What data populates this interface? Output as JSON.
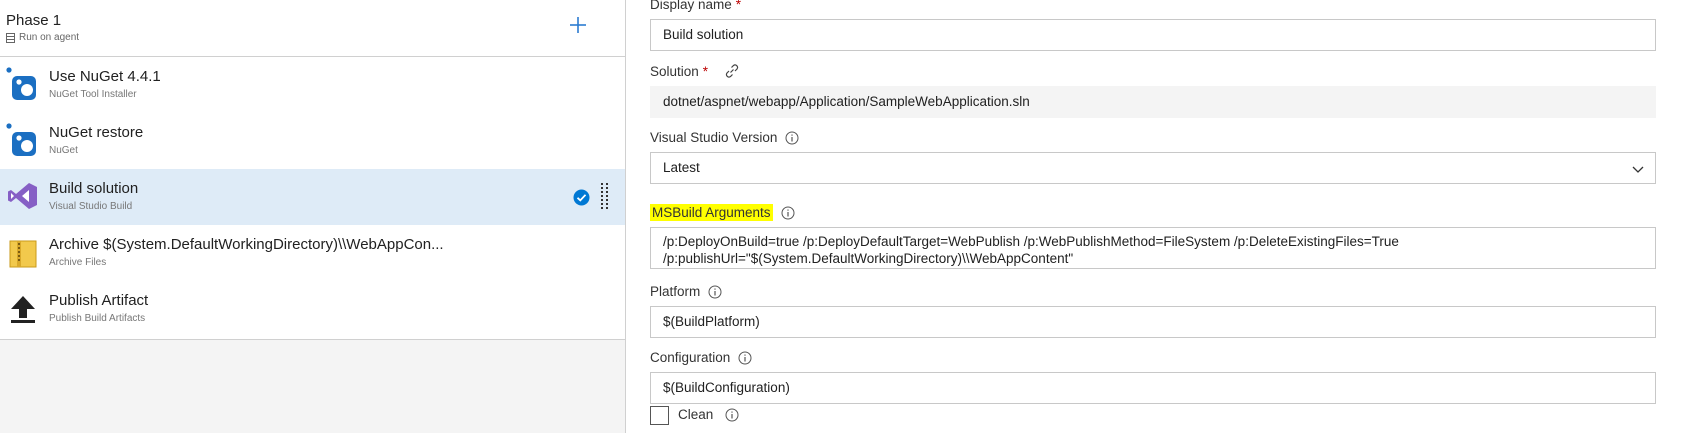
{
  "phase": {
    "title": "Phase 1",
    "subtitle": "Run on agent",
    "icons": {
      "agent": "server-icon",
      "add": "plus-icon"
    }
  },
  "tasks": [
    {
      "title": "Use NuGet 4.4.1",
      "subtitle": "NuGet Tool Installer",
      "icon": "nuget-icon",
      "selected": false
    },
    {
      "title": "NuGet restore",
      "subtitle": "NuGet",
      "icon": "nuget-icon",
      "selected": false
    },
    {
      "title": "Build solution",
      "subtitle": "Visual Studio Build",
      "icon": "visual-studio-icon",
      "selected": true
    },
    {
      "title": "Archive $(System.DefaultWorkingDirectory)\\\\WebAppCon...",
      "subtitle": "Archive Files",
      "icon": "archive-icon",
      "selected": false
    },
    {
      "title": "Publish Artifact",
      "subtitle": "Publish Build Artifacts",
      "icon": "upload-arrow-icon",
      "selected": false
    }
  ],
  "form": {
    "display_name": {
      "label": "Display name",
      "required": "*",
      "value": "Build solution"
    },
    "solution": {
      "label": "Solution",
      "required": "*",
      "value": "dotnet/aspnet/webapp/Application/SampleWebApplication.sln"
    },
    "vs_version": {
      "label": "Visual Studio Version",
      "value": "Latest"
    },
    "msbuild_args": {
      "label": "MSBuild Arguments",
      "line1": "/p:DeployOnBuild=true /p:DeployDefaultTarget=WebPublish   /p:WebPublishMethod=FileSystem  /p:DeleteExistingFiles=True",
      "line2": "/p:publishUrl=\"$(System.DefaultWorkingDirectory)\\\\WebAppContent\""
    },
    "platform": {
      "label": "Platform",
      "value": "$(BuildPlatform)"
    },
    "configuration": {
      "label": "Configuration",
      "value": "$(BuildConfiguration)"
    },
    "clean": {
      "label": "Clean",
      "checked": false
    }
  },
  "colors": {
    "selected_row": "#deebf7",
    "highlight": "#ffff00",
    "accent": "#0078d4",
    "required": "#b00000"
  }
}
